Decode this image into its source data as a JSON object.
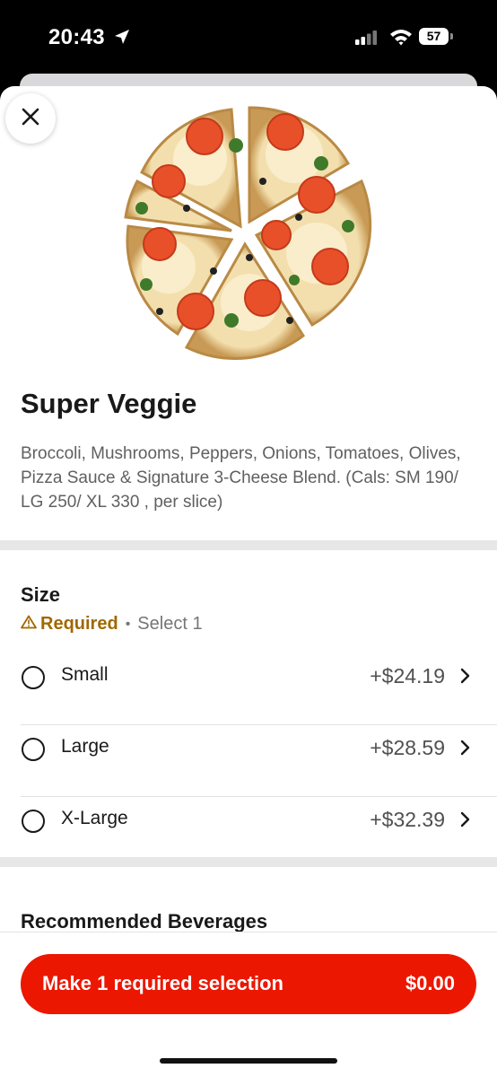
{
  "status_bar": {
    "time": "20:43",
    "battery": "57",
    "icons": [
      "location-arrow-icon",
      "signal-icon",
      "wifi-icon",
      "battery-icon"
    ]
  },
  "item": {
    "title": "Super Veggie",
    "description": "Broccoli, Mushrooms, Peppers, Onions, Tomatoes, Olives, Pizza Sauce & Signature 3-Cheese Blend. (Cals: SM 190/ LG 250/ XL 330 , per slice)"
  },
  "size_section": {
    "title": "Size",
    "required_label": "Required",
    "select_text": "Select 1",
    "options": [
      {
        "label": "Small",
        "price": "+$24.19"
      },
      {
        "label": "Large",
        "price": "+$28.59"
      },
      {
        "label": "X-Large",
        "price": "+$32.39"
      }
    ]
  },
  "beverages_section": {
    "title": "Recommended Beverages"
  },
  "cta": {
    "label": "Make 1 required selection",
    "price": "$0.00"
  },
  "colors": {
    "accent": "#eb1700",
    "required": "#a06800",
    "text": "#191919",
    "muted": "#606060"
  }
}
